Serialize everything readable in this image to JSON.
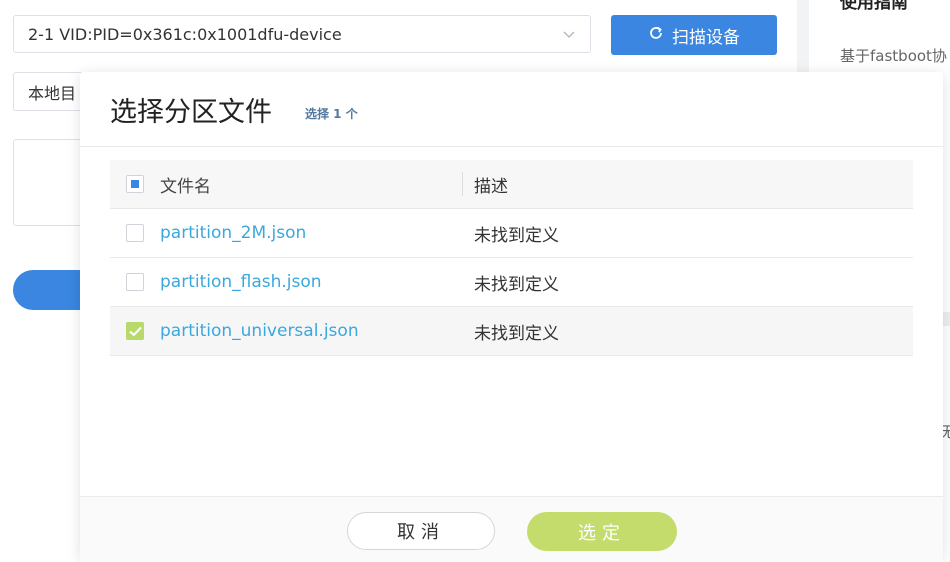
{
  "device": {
    "selected": "2-1 VID:PID=0x361c:0x1001dfu-device"
  },
  "scan_button": {
    "label": "扫描设备"
  },
  "local_select": {
    "value": "本地目"
  },
  "guide": {
    "title": "使用指南",
    "text": "基于fastboot协"
  },
  "side_glyph": "无",
  "modal": {
    "title": "选择分区文件",
    "count": "选择 1 个",
    "columns": {
      "name": "文件名",
      "desc": "描述"
    },
    "rows": [
      {
        "name": "partition_2M.json",
        "desc": "未找到定义",
        "checked": false
      },
      {
        "name": "partition_flash.json",
        "desc": "未找到定义",
        "checked": false
      },
      {
        "name": "partition_universal.json",
        "desc": "未找到定义",
        "checked": true
      }
    ],
    "cancel": "取消",
    "confirm": "选定"
  },
  "colors": {
    "primary": "#3a86e0",
    "accent_green": "#c3dc6c",
    "link": "#3aa8df"
  }
}
